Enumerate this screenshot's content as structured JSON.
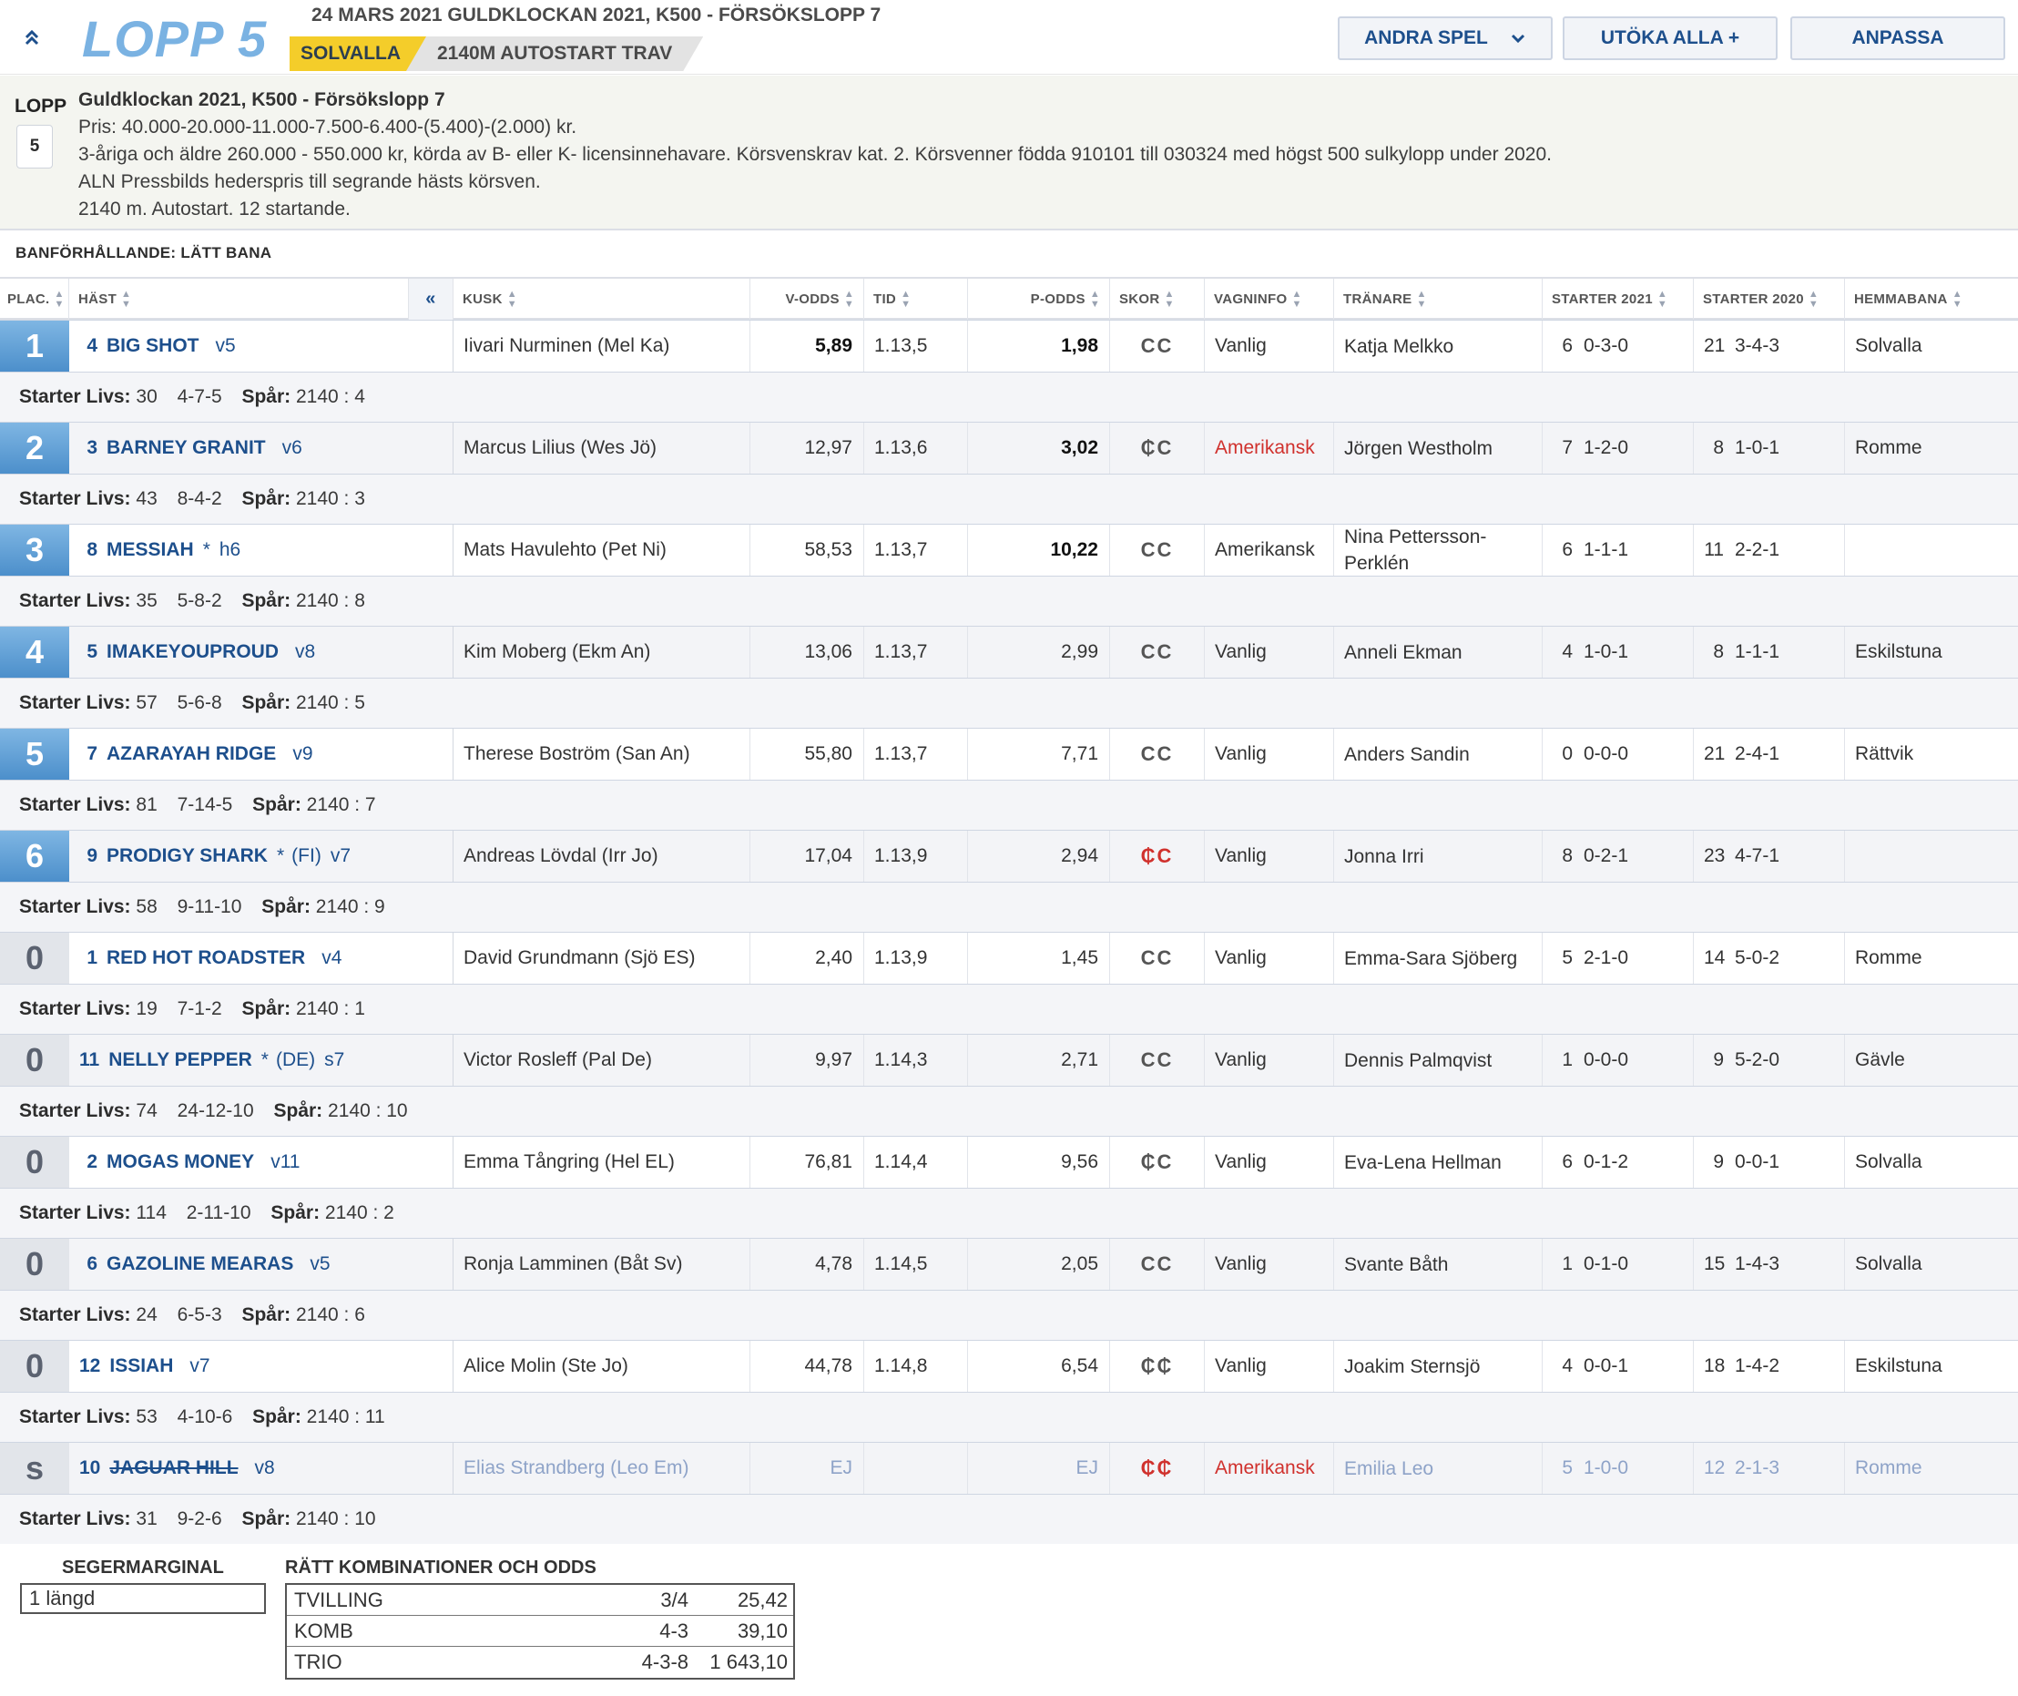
{
  "header": {
    "race_title": "LOPP 5",
    "race_subtitle": "24 MARS 2021 GULDKLOCKAN 2021, K500 - FÖRSÖKSLOPP 7",
    "track": "SOLVALLA",
    "distance": "2140M AUTOSTART TRAV",
    "buttons": {
      "andra_spel": "ANDRA SPEL",
      "utoka_alla": "UTÖKA ALLA +",
      "anpassa": "ANPASSA"
    }
  },
  "race_info": {
    "lopp_label": "LOPP",
    "lopp_number": "5",
    "lines": [
      "Guldklockan 2021, K500 - Försökslopp 7",
      "Pris: 40.000-20.000-11.000-7.500-6.400-(5.400)-(2.000) kr.",
      "3-åriga och äldre 260.000 - 550.000 kr, körda av B- eller K- licensinnehavare. Körsvenskrav kat. 2. Körsvenner födda 910101 till 030324 med högst 500 sulkylopp under 2020.",
      "ALN Pressbilds hederspris till segrande hästs körsven.",
      "2140 m. Autostart. 12 startande."
    ]
  },
  "track_condition": "BANFÖRHÅLLANDE: LÄTT BANA",
  "columns": {
    "plac": "PLAC.",
    "hast": "HÄST",
    "collapse": "«",
    "kusk": "KUSK",
    "vodds": "V-ODDS",
    "tid": "TID",
    "podds": "P-ODDS",
    "skor": "SKOR",
    "vagn": "VAGNINFO",
    "tranare": "TRÄNARE",
    "st21": "STARTER 2021",
    "st20": "STARTER 2020",
    "hem": "HEMMABANA"
  },
  "sub_labels": {
    "livs": "Starter Livs:",
    "spar": "Spår:"
  },
  "results": [
    {
      "plac": "1",
      "num": "4",
      "name": "BIG SHOT",
      "star": "",
      "country": "",
      "age": "v5",
      "kusk": "Iivari Nurminen (Mel Ka)",
      "vodds": "5,89",
      "tid": "1.13,5",
      "podds": "1,98",
      "skor": "CC",
      "vagn": "Vanlig",
      "tranare": "Katja Melkko",
      "s21n": "6",
      "s21": "0-3-0",
      "s20n": "21",
      "s20": "3-4-3",
      "hem": "Solvalla",
      "livs_n": "30",
      "livs": "4-7-5",
      "spar": "2140 : 4"
    },
    {
      "plac": "2",
      "num": "3",
      "name": "BARNEY GRANIT",
      "star": "",
      "country": "",
      "age": "v6",
      "kusk": "Marcus Lilius (Wes Jö)",
      "vodds": "12,97",
      "tid": "1.13,6",
      "podds": "3,02",
      "skor": "₵C",
      "vagn": "Amerikansk",
      "tranare": "Jörgen Westholm",
      "s21n": "7",
      "s21": "1-2-0",
      "s20n": "8",
      "s20": "1-0-1",
      "hem": "Romme",
      "livs_n": "43",
      "livs": "8-4-2",
      "spar": "2140 : 3"
    },
    {
      "plac": "3",
      "num": "8",
      "name": "MESSIAH",
      "star": "*",
      "country": "",
      "age": "h6",
      "kusk": "Mats Havulehto (Pet Ni)",
      "vodds": "58,53",
      "tid": "1.13,7",
      "podds": "10,22",
      "skor": "CC",
      "vagn": "Amerikansk",
      "tranare": "Nina Pettersson-Perklén",
      "s21n": "6",
      "s21": "1-1-1",
      "s20n": "11",
      "s20": "2-2-1",
      "hem": "",
      "livs_n": "35",
      "livs": "5-8-2",
      "spar": "2140 : 8"
    },
    {
      "plac": "4",
      "num": "5",
      "name": "IMAKEYOUPROUD",
      "star": "",
      "country": "",
      "age": "v8",
      "kusk": "Kim Moberg (Ekm An)",
      "vodds": "13,06",
      "tid": "1.13,7",
      "podds": "2,99",
      "skor": "CC",
      "vagn": "Vanlig",
      "tranare": "Anneli Ekman",
      "s21n": "4",
      "s21": "1-0-1",
      "s20n": "8",
      "s20": "1-1-1",
      "hem": "Eskilstuna",
      "livs_n": "57",
      "livs": "5-6-8",
      "spar": "2140 : 5"
    },
    {
      "plac": "5",
      "num": "7",
      "name": "AZARAYAH RIDGE",
      "star": "",
      "country": "",
      "age": "v9",
      "kusk": "Therese Boström (San An)",
      "vodds": "55,80",
      "tid": "1.13,7",
      "podds": "7,71",
      "skor": "CC",
      "vagn": "Vanlig",
      "tranare": "Anders Sandin",
      "s21n": "0",
      "s21": "0-0-0",
      "s20n": "21",
      "s20": "2-4-1",
      "hem": "Rättvik",
      "livs_n": "81",
      "livs": "7-14-5",
      "spar": "2140 : 7"
    },
    {
      "plac": "6",
      "num": "9",
      "name": "PRODIGY SHARK",
      "star": "*",
      "country": "(FI)",
      "age": "v7",
      "kusk": "Andreas Lövdal (Irr Jo)",
      "vodds": "17,04",
      "tid": "1.13,9",
      "podds": "2,94",
      "skor": "₵C",
      "vagn": "Vanlig",
      "tranare": "Jonna Irri",
      "s21n": "8",
      "s21": "0-2-1",
      "s20n": "23",
      "s20": "4-7-1",
      "hem": "",
      "livs_n": "58",
      "livs": "9-11-10",
      "spar": "2140 : 9"
    },
    {
      "plac": "0",
      "num": "1",
      "name": "RED HOT ROADSTER",
      "star": "",
      "country": "",
      "age": "v4",
      "kusk": "David Grundmann (Sjö ES)",
      "vodds": "2,40",
      "tid": "1.13,9",
      "podds": "1,45",
      "skor": "CC",
      "vagn": "Vanlig",
      "tranare": "Emma-Sara Sjöberg",
      "s21n": "5",
      "s21": "2-1-0",
      "s20n": "14",
      "s20": "5-0-2",
      "hem": "Romme",
      "livs_n": "19",
      "livs": "7-1-2",
      "spar": "2140 : 1"
    },
    {
      "plac": "0",
      "num": "11",
      "name": "NELLY PEPPER",
      "star": "*",
      "country": "(DE)",
      "age": "s7",
      "kusk": "Victor Rosleff (Pal De)",
      "vodds": "9,97",
      "tid": "1.14,3",
      "podds": "2,71",
      "skor": "CC",
      "vagn": "Vanlig",
      "tranare": "Dennis Palmqvist",
      "s21n": "1",
      "s21": "0-0-0",
      "s20n": "9",
      "s20": "5-2-0",
      "hem": "Gävle",
      "livs_n": "74",
      "livs": "24-12-10",
      "spar": "2140 : 10"
    },
    {
      "plac": "0",
      "num": "2",
      "name": "MOGAS MONEY",
      "star": "",
      "country": "",
      "age": "v11",
      "kusk": "Emma Tångring (Hel EL)",
      "vodds": "76,81",
      "tid": "1.14,4",
      "podds": "9,56",
      "skor": "₵C",
      "vagn": "Vanlig",
      "tranare": "Eva-Lena Hellman",
      "s21n": "6",
      "s21": "0-1-2",
      "s20n": "9",
      "s20": "0-0-1",
      "hem": "Solvalla",
      "livs_n": "114",
      "livs": "2-11-10",
      "spar": "2140 : 2"
    },
    {
      "plac": "0",
      "num": "6",
      "name": "GAZOLINE MEARAS",
      "star": "",
      "country": "",
      "age": "v5",
      "kusk": "Ronja Lamminen (Båt Sv)",
      "vodds": "4,78",
      "tid": "1.14,5",
      "podds": "2,05",
      "skor": "CC",
      "vagn": "Vanlig",
      "tranare": "Svante Båth",
      "s21n": "1",
      "s21": "0-1-0",
      "s20n": "15",
      "s20": "1-4-3",
      "hem": "Solvalla",
      "livs_n": "24",
      "livs": "6-5-3",
      "spar": "2140 : 6"
    },
    {
      "plac": "0",
      "num": "12",
      "name": "ISSIAH",
      "star": "",
      "country": "",
      "age": "v7",
      "kusk": "Alice Molin (Ste Jo)",
      "vodds": "44,78",
      "tid": "1.14,8",
      "podds": "6,54",
      "skor": "₵₵",
      "vagn": "Vanlig",
      "tranare": "Joakim Sternsjö",
      "s21n": "4",
      "s21": "0-0-1",
      "s20n": "18",
      "s20": "1-4-2",
      "hem": "Eskilstuna",
      "livs_n": "53",
      "livs": "4-10-6",
      "spar": "2140 : 11"
    },
    {
      "plac": "s",
      "num": "10",
      "name": "JAGUAR HILL",
      "star": "",
      "country": "",
      "age": "v8",
      "kusk": "Elias Strandberg (Leo Em)",
      "vodds": "EJ",
      "tid": "",
      "podds": "EJ",
      "skor": "₵₵",
      "vagn": "Amerikansk",
      "tranare": "Emilia Leo",
      "s21n": "5",
      "s21": "1-0-0",
      "s20n": "12",
      "s20": "2-1-3",
      "hem": "Romme",
      "livs_n": "31",
      "livs": "9-2-6",
      "spar": "2140 : 10"
    }
  ],
  "footer": {
    "segermarginal_label": "SEGERMARGINAL",
    "segermarginal": "1 längd",
    "combos_label": "RÄTT KOMBINATIONER OCH ODDS",
    "combos": [
      {
        "type": "TVILLING",
        "combo": "3/4",
        "odds": "25,42"
      },
      {
        "type": "KOMB",
        "combo": "4-3",
        "odds": "39,10"
      },
      {
        "type": "TRIO",
        "combo": "4-3-8",
        "odds": "1 643,10"
      }
    ]
  },
  "colors": {
    "accent_blue": "#1d4f8c",
    "title_blue": "#7ab2e2",
    "track_yellow": "#f4cd2a",
    "alert_red": "#d0312d"
  }
}
